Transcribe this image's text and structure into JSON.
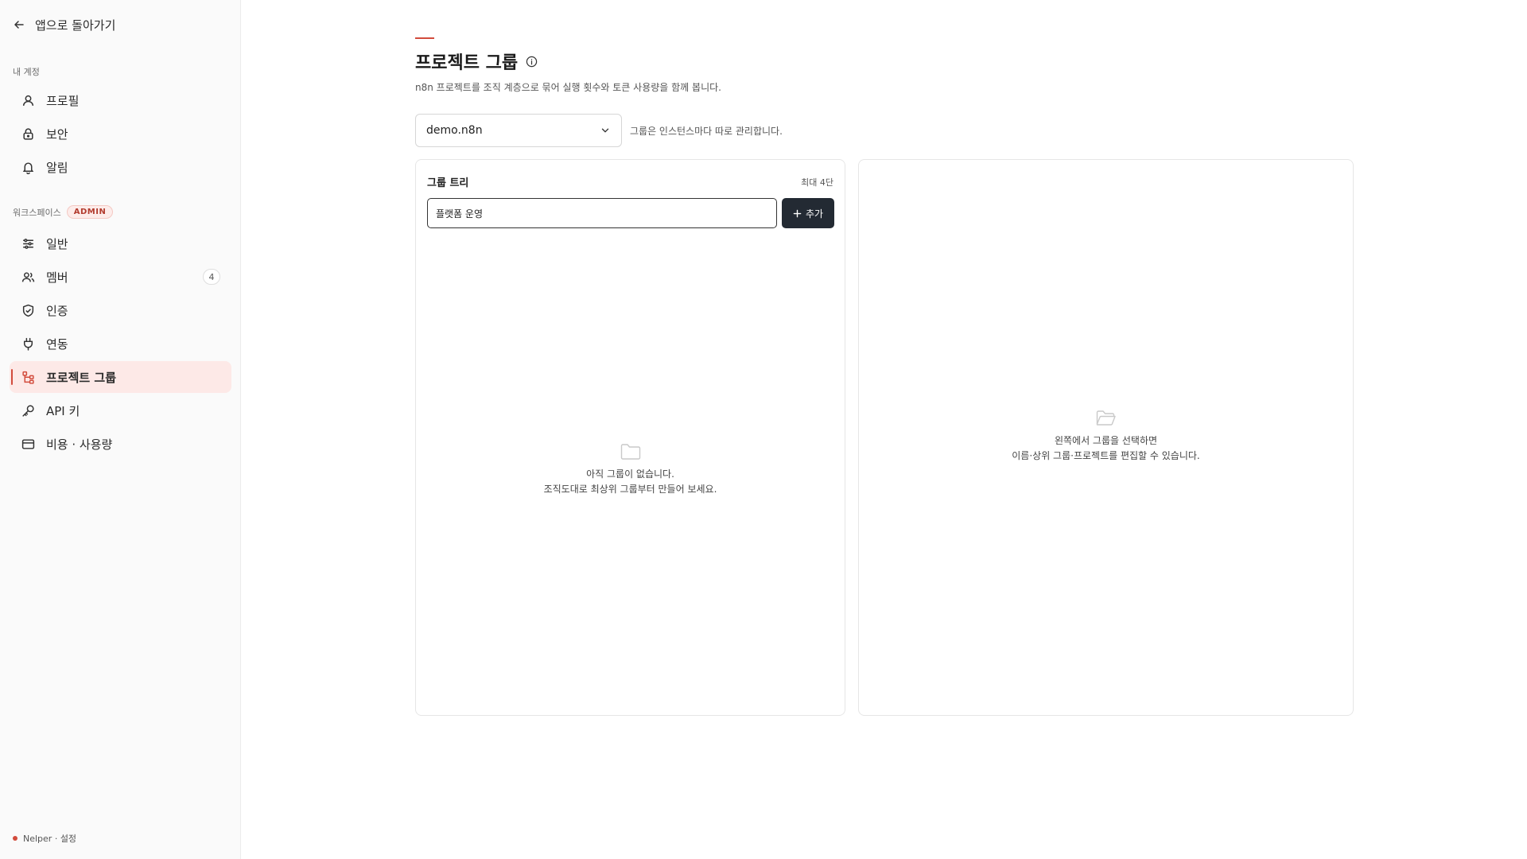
{
  "sidebar": {
    "back_label": "앱으로 돌아가기",
    "account_section": "내 계정",
    "account_items": [
      {
        "label": "프로필",
        "icon": "user-icon"
      },
      {
        "label": "보안",
        "icon": "lock-icon"
      },
      {
        "label": "알림",
        "icon": "bell-icon"
      }
    ],
    "workspace_section": "워크스페이스",
    "workspace_badge": "ADMIN",
    "workspace_items": [
      {
        "label": "일반",
        "icon": "sliders-icon"
      },
      {
        "label": "멤버",
        "icon": "users-icon",
        "count": "4"
      },
      {
        "label": "인증",
        "icon": "shield-icon"
      },
      {
        "label": "연동",
        "icon": "plug-icon"
      },
      {
        "label": "프로젝트 그룹",
        "icon": "hierarchy-icon",
        "active": true
      },
      {
        "label": "API 키",
        "icon": "key-icon"
      },
      {
        "label": "비용 · 사용량",
        "icon": "card-icon"
      }
    ],
    "footer": "Nelper · 설정"
  },
  "main": {
    "title": "프로젝트 그룹",
    "subtitle": "n8n 프로젝트를 조직 계층으로 묶어 실행 횟수와 토큰 사용량을 함께 봅니다.",
    "instance_select": {
      "value": "demo.n8n"
    },
    "instance_hint": "그룹은 인스턴스마다 따로 관리합니다.",
    "tree_panel": {
      "title": "그룹 트리",
      "meta": "최대 4단",
      "input_value": "플랫폼 운영",
      "add_label": "추가",
      "empty_line1": "아직 그룹이 없습니다.",
      "empty_line2": "조직도대로 최상위 그룹부터 만들어 보세요."
    },
    "detail_panel": {
      "empty_line1": "왼쪽에서 그룹을 선택하면",
      "empty_line2": "이름·상위 그룹·프로젝트를 편집할 수 있습니다."
    }
  },
  "colors": {
    "accent": "#d24b3c",
    "active_bg": "#fde9e7",
    "button_dark": "#232a33"
  }
}
